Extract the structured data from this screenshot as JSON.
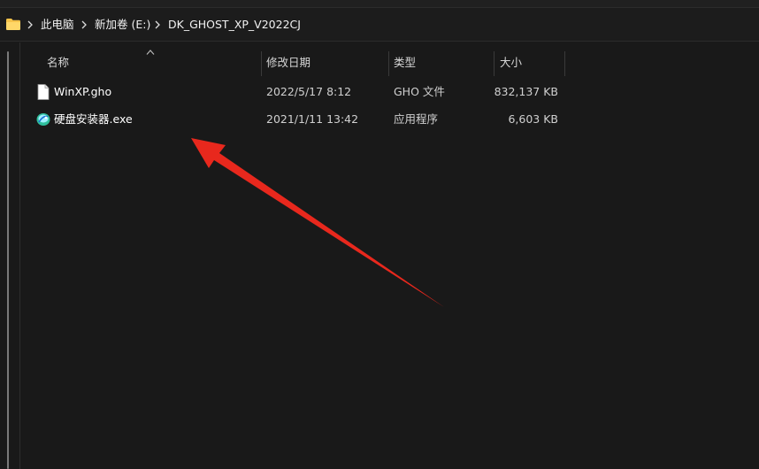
{
  "address_bar": {
    "breadcrumbs": [
      "此电脑",
      "新加卷 (E:)",
      "DK_GHOST_XP_V2022CJ"
    ]
  },
  "columns": {
    "name": "名称",
    "modified": "修改日期",
    "type": "类型",
    "size": "大小"
  },
  "files": [
    {
      "name": "WinXP.gho",
      "modified": "2022/5/17 8:12",
      "type": "GHO 文件",
      "size": "832,137 KB",
      "icon": "document-icon"
    },
    {
      "name": "硬盘安装器.exe",
      "modified": "2021/1/11 13:42",
      "type": "应用程序",
      "size": "6,603 KB",
      "icon": "installer-app-icon"
    }
  ],
  "colors": {
    "background": "#191919",
    "folder": "#f6c34a",
    "annotation_arrow": "#e8281d"
  }
}
